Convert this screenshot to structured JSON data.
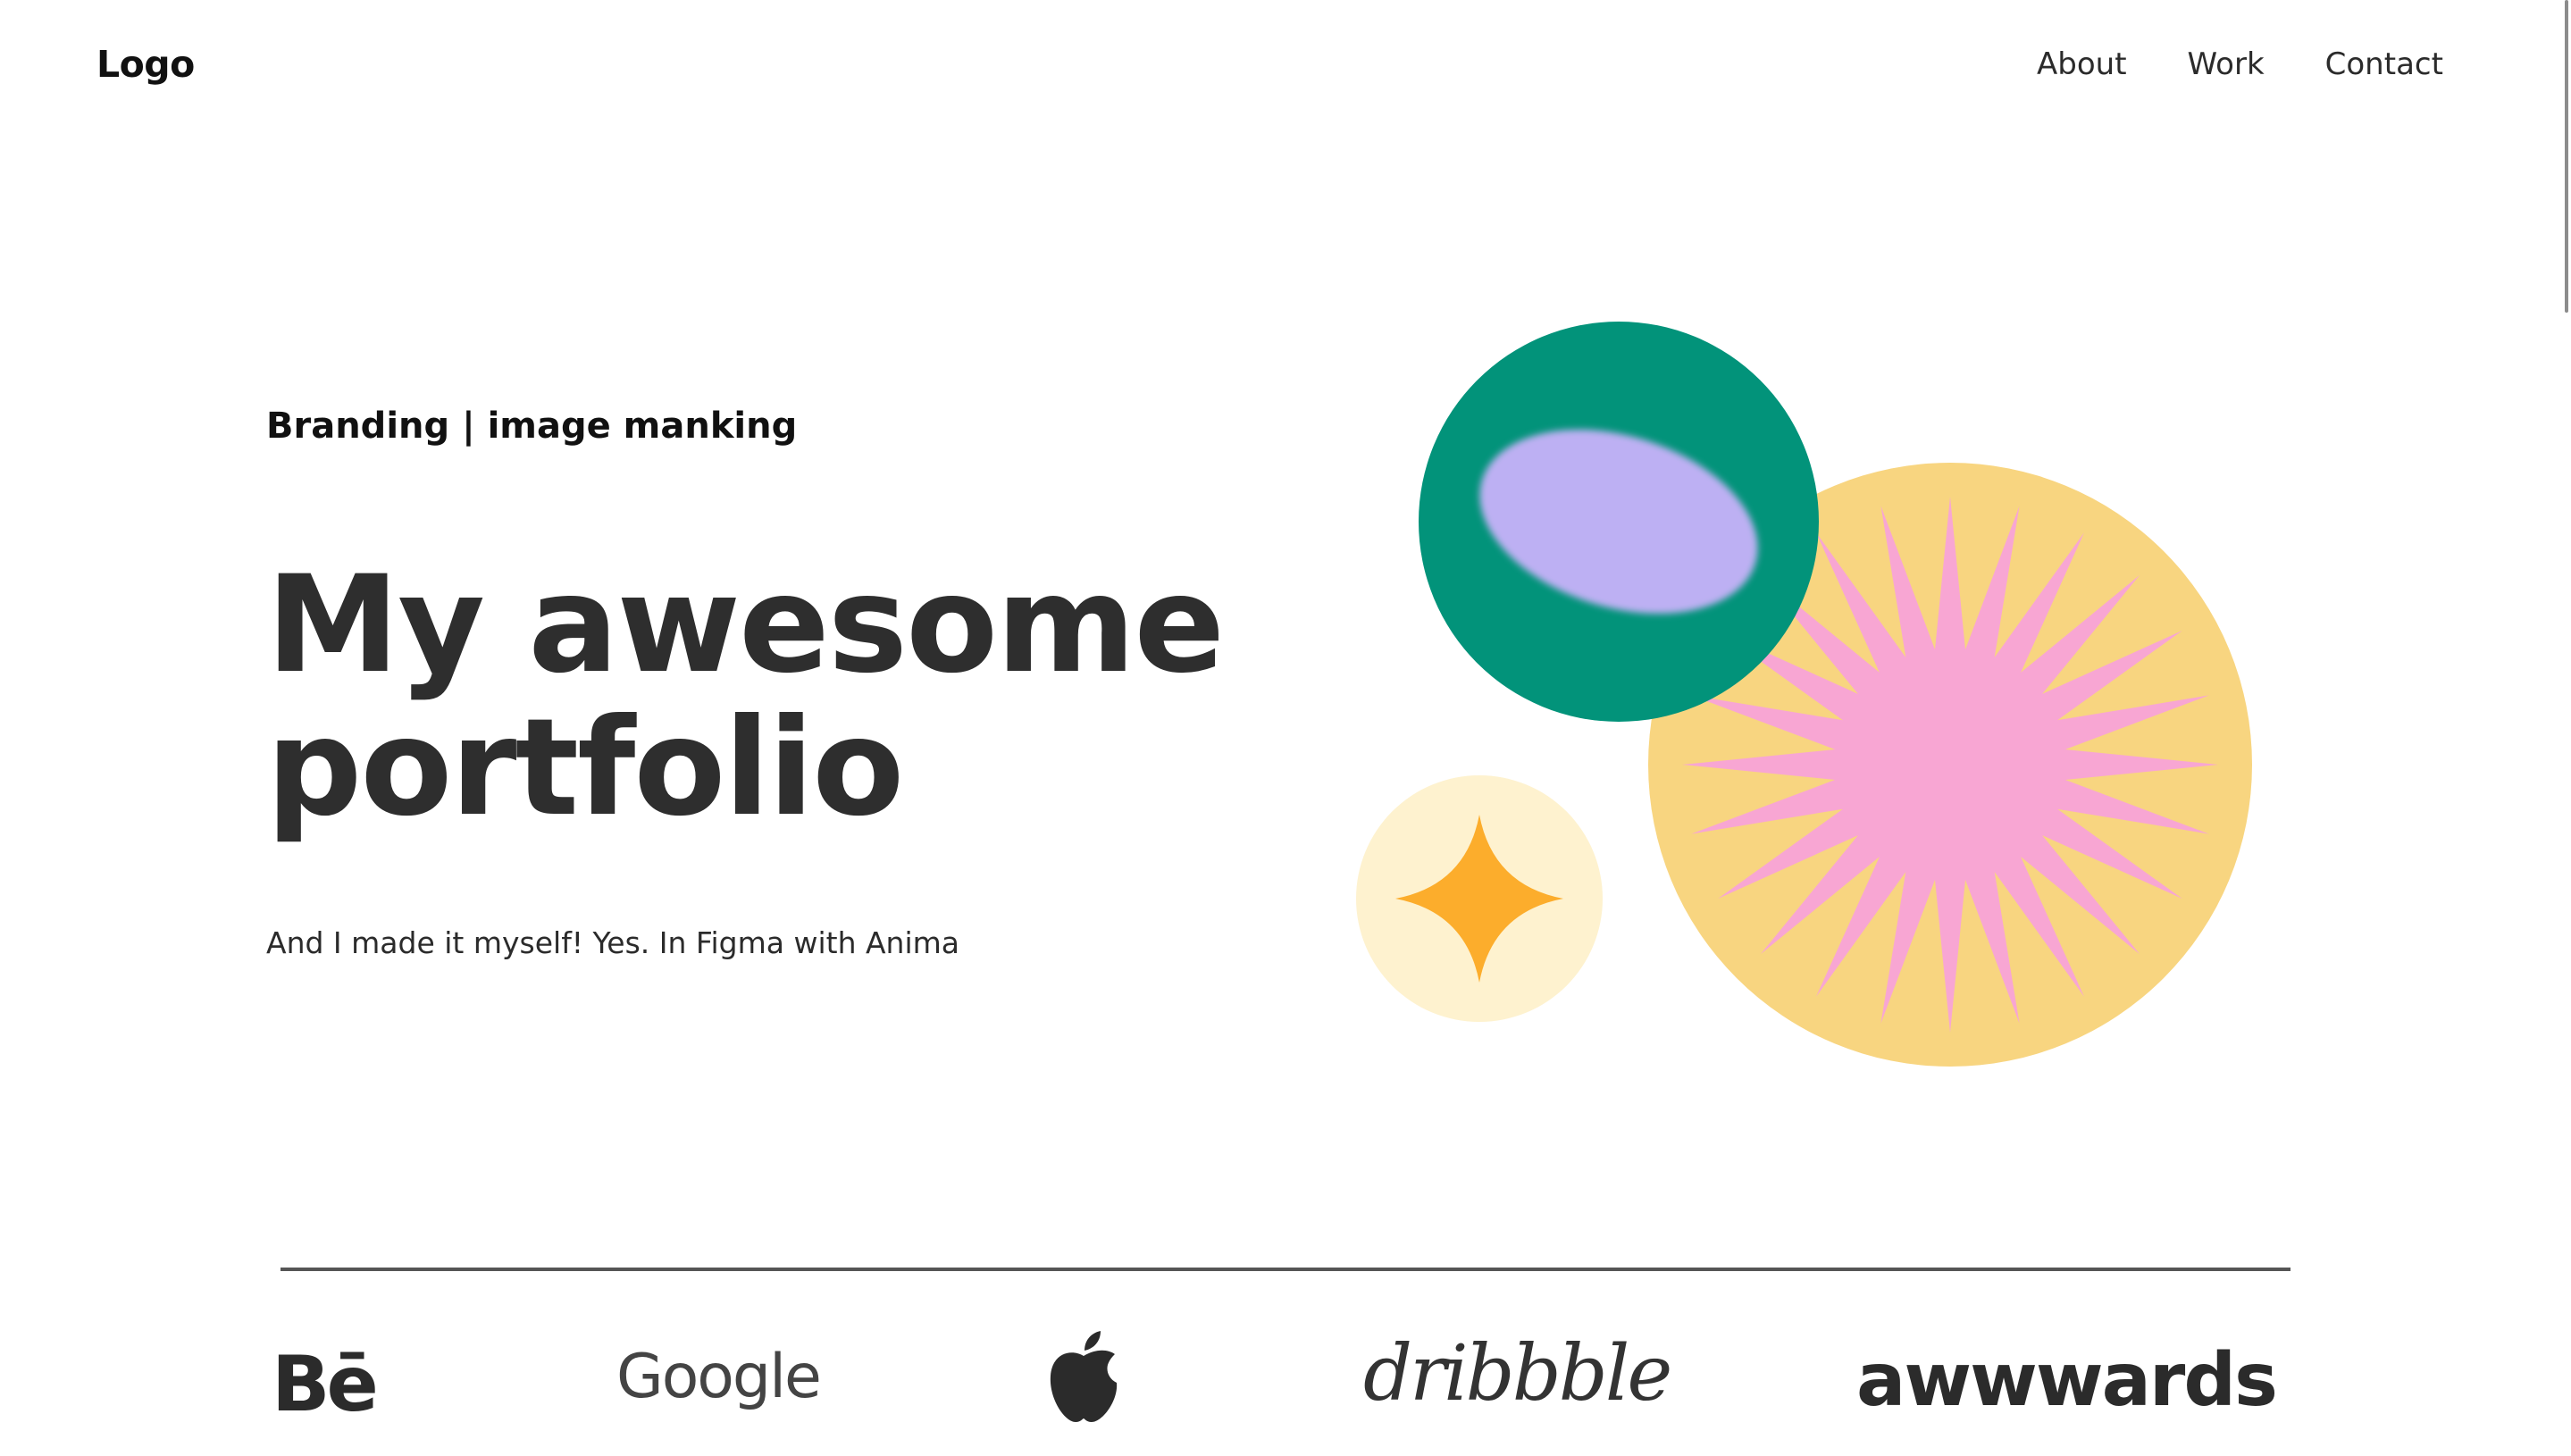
{
  "header": {
    "logo": "Logo",
    "nav": [
      {
        "label": "About"
      },
      {
        "label": "Work"
      },
      {
        "label": "Contact"
      }
    ]
  },
  "hero": {
    "tagline": "Branding | image manking",
    "title_line1": "My awesome",
    "title_line2": "portfolio",
    "subtitle": "And I made it myself! Yes. In Figma with Anima",
    "illustration": {
      "green_circle_color": "#02937a",
      "lilac_ellipse_color": "#bdb0f3",
      "yellow_circle_color": "#f8d580",
      "pink_starburst_color": "#f8a6d3",
      "cream_circle_color": "#fef2cf",
      "orange_star_color": "#fcad2c"
    }
  },
  "brands": {
    "behance": "Bē",
    "google": "Google",
    "apple_icon": "apple-logo-icon",
    "dribbble": "dribbble",
    "awwwards": "awwwards"
  }
}
